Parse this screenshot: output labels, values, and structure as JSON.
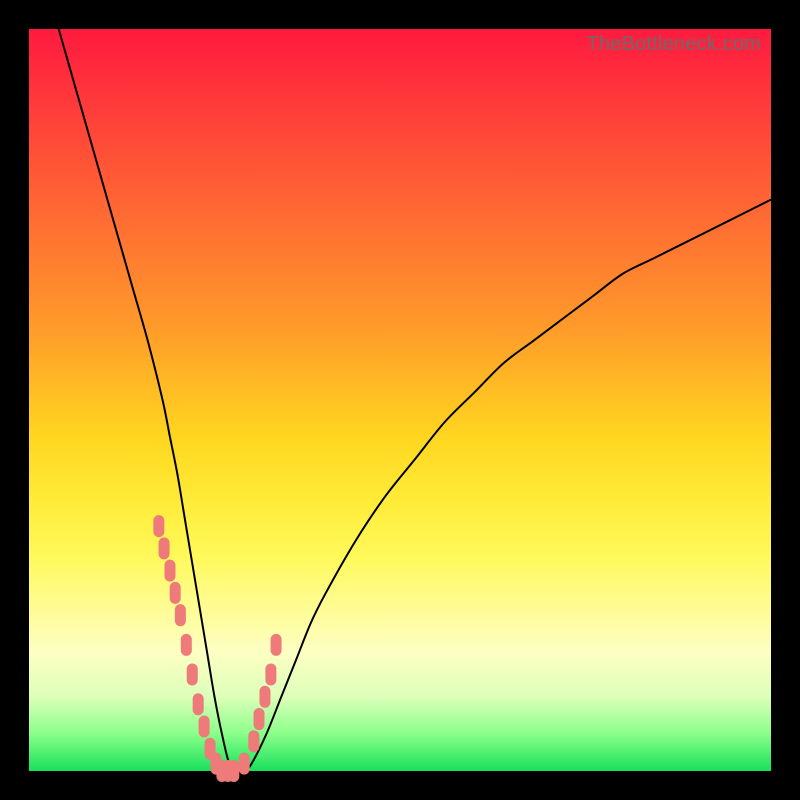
{
  "watermark": "TheBottleneck.com",
  "colors": {
    "frame": "#000000",
    "curve": "#000000",
    "marker": "#ee7a7a"
  },
  "chart_data": {
    "type": "line",
    "title": "",
    "xlabel": "",
    "ylabel": "",
    "xlim": [
      0,
      100
    ],
    "ylim": [
      0,
      100
    ],
    "x": [
      4,
      6,
      8,
      10,
      12,
      14,
      16,
      18,
      19,
      20,
      21,
      22,
      23,
      24,
      25,
      26,
      27,
      28,
      29,
      30,
      32,
      34,
      36,
      38,
      40,
      44,
      48,
      52,
      56,
      60,
      64,
      68,
      72,
      76,
      80,
      84,
      88,
      92,
      96,
      100
    ],
    "values": [
      100,
      93,
      86,
      79,
      72,
      65,
      58,
      50,
      45,
      40,
      34,
      28,
      22,
      16,
      10,
      5,
      1,
      0,
      0,
      1,
      5,
      10,
      15,
      20,
      24,
      31,
      37,
      42,
      47,
      51,
      55,
      58,
      61,
      64,
      67,
      69,
      71,
      73,
      75,
      77
    ],
    "markers_x": [
      17.5,
      18.2,
      19.0,
      19.7,
      20.4,
      21.2,
      22.0,
      22.8,
      23.6,
      24.4,
      25.2,
      26.0,
      26.8,
      27.6,
      29.0,
      30.3,
      31.0,
      31.8,
      32.6,
      33.3
    ],
    "markers_y": [
      33,
      30,
      27,
      24,
      21,
      17,
      13,
      9,
      6,
      3,
      1,
      0,
      0,
      0,
      1,
      4,
      7,
      10,
      13,
      17
    ],
    "background_gradient": [
      "#ff1a3f",
      "#ff9a2a",
      "#ffec3a",
      "#8aff8a",
      "#18e05a"
    ]
  }
}
